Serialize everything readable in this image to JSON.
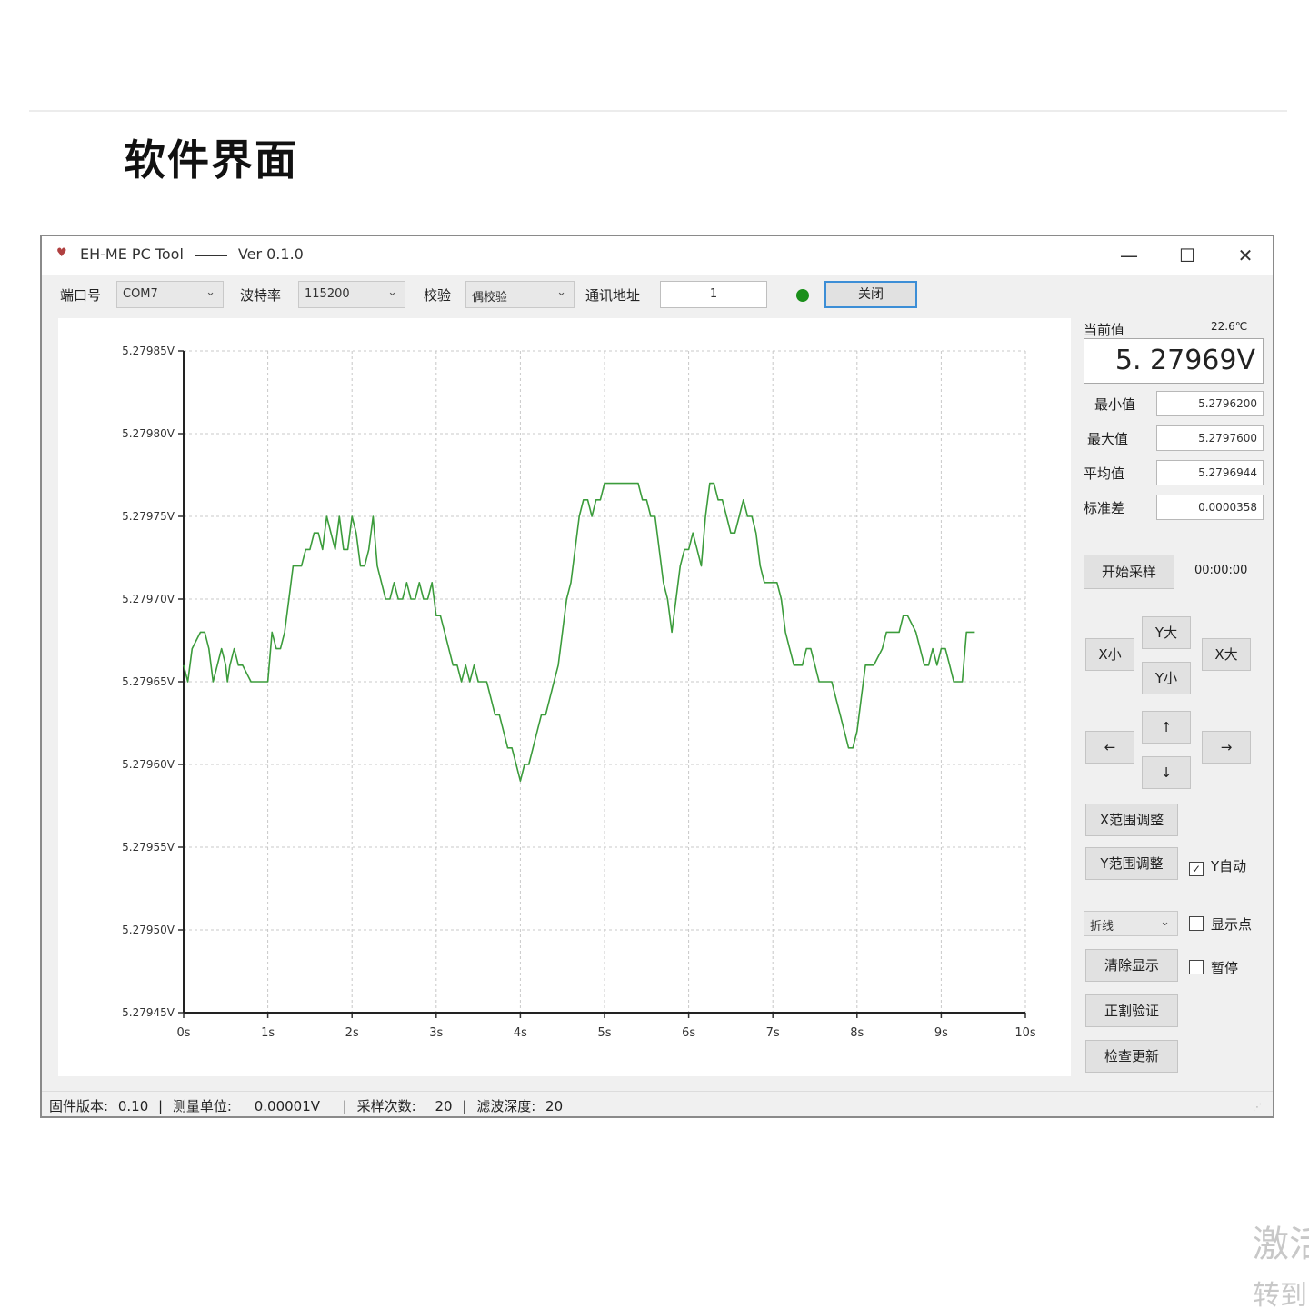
{
  "page": {
    "heading": "软件界面"
  },
  "window": {
    "title": "EH-ME PC Tool",
    "version": "Ver 0.1.0",
    "controls": {
      "minimize": "—",
      "maximize": "☐",
      "close": "✕"
    }
  },
  "toolbar": {
    "port_label": "端口号",
    "port_value": "COM7",
    "baud_label": "波特率",
    "baud_value": "115200",
    "parity_label": "校验",
    "parity_value": "偶校验",
    "address_label": "通讯地址",
    "address_value": "1",
    "connect_button": "关闭",
    "status_color": "#1a8f1a"
  },
  "panel": {
    "current_label": "当前值",
    "temperature": "22.6℃",
    "current_value": "5. 27969V",
    "stats": [
      {
        "label": "最小值",
        "value": "5.2796200"
      },
      {
        "label": "最大值",
        "value": "5.2797600"
      },
      {
        "label": "平均值",
        "value": "5.2796944"
      },
      {
        "label": "标准差",
        "value": "0.0000358"
      }
    ],
    "start_button": "开始采样",
    "timer": "00:00:00",
    "zoom": {
      "x_small": "X小",
      "y_big": "Y大",
      "y_small": "Y小",
      "x_big": "X大"
    },
    "arrows": {
      "left": "←",
      "up": "↑",
      "down": "↓",
      "right": "→"
    },
    "x_range_button": "X范围调整",
    "y_range_button": "Y范围调整",
    "y_auto_label": "Y自动",
    "y_auto_checked": true,
    "chart_type_value": "折线",
    "show_points_label": "显示点",
    "show_points_checked": false,
    "clear_button": "清除显示",
    "pause_label": "暂停",
    "pause_checked": false,
    "calibrate_button": "正割验证",
    "update_button": "检查更新"
  },
  "statusbar": {
    "fw_label": "固件版本:",
    "fw_value": "0.10",
    "unit_label": "测量单位:",
    "unit_value": "0.00001V",
    "samples_label": "采样次数:",
    "samples_value": "20",
    "filter_label": "滤波深度:",
    "filter_value": "20",
    "separator": "|"
  },
  "corner": {
    "line1": "激活",
    "line2": "转到"
  },
  "chart_data": {
    "type": "line",
    "color": "#3c9c3c",
    "x_ticks": [
      "0s",
      "1s",
      "2s",
      "3s",
      "4s",
      "5s",
      "6s",
      "7s",
      "8s",
      "9s",
      "10s"
    ],
    "y_ticks": [
      "5.27985V",
      "5.27980V",
      "5.27975V",
      "5.27970V",
      "5.27965V",
      "5.27960V",
      "5.27955V",
      "5.27950V",
      "5.27945V"
    ],
    "xlim": [
      0,
      10
    ],
    "ylim": [
      5.27945,
      5.27985
    ],
    "grid": true,
    "x": [
      0,
      0.05,
      0.1,
      0.2,
      0.25,
      0.3,
      0.35,
      0.45,
      0.5,
      0.52,
      0.55,
      0.6,
      0.65,
      0.7,
      0.8,
      0.85,
      0.9,
      1.0,
      1.05,
      1.1,
      1.15,
      1.2,
      1.25,
      1.3,
      1.35,
      1.4,
      1.45,
      1.5,
      1.55,
      1.6,
      1.65,
      1.7,
      1.75,
      1.8,
      1.85,
      1.9,
      1.95,
      2.0,
      2.05,
      2.1,
      2.15,
      2.2,
      2.25,
      2.3,
      2.35,
      2.4,
      2.45,
      2.5,
      2.55,
      2.6,
      2.65,
      2.7,
      2.75,
      2.8,
      2.85,
      2.9,
      2.95,
      3.0,
      3.05,
      3.1,
      3.15,
      3.2,
      3.25,
      3.3,
      3.35,
      3.4,
      3.45,
      3.5,
      3.6,
      3.65,
      3.7,
      3.75,
      3.8,
      3.85,
      3.9,
      3.95,
      4.0,
      4.05,
      4.1,
      4.15,
      4.2,
      4.25,
      4.3,
      4.35,
      4.4,
      4.45,
      4.5,
      4.55,
      4.6,
      4.65,
      4.7,
      4.75,
      4.8,
      4.85,
      4.9,
      4.95,
      5.0,
      5.1,
      5.2,
      5.3,
      5.4,
      5.45,
      5.5,
      5.55,
      5.6,
      5.65,
      5.7,
      5.75,
      5.8,
      5.85,
      5.9,
      5.95,
      6.0,
      6.05,
      6.1,
      6.15,
      6.2,
      6.25,
      6.3,
      6.35,
      6.4,
      6.45,
      6.5,
      6.55,
      6.6,
      6.65,
      6.7,
      6.75,
      6.8,
      6.85,
      6.9,
      7.0,
      7.05,
      7.1,
      7.15,
      7.2,
      7.25,
      7.3,
      7.35,
      7.4,
      7.45,
      7.5,
      7.55,
      7.6,
      7.65,
      7.7,
      7.75,
      7.8,
      7.85,
      7.9,
      7.95,
      8.0,
      8.05,
      8.1,
      8.15,
      8.2,
      8.3,
      8.35,
      8.4,
      8.5,
      8.55,
      8.6,
      8.7,
      8.8,
      8.85,
      8.9,
      8.95,
      9.0,
      9.05,
      9.1,
      9.15,
      9.2,
      9.25,
      9.3,
      9.4,
      9.45,
      9.5,
      9.6,
      9.65,
      9.7,
      9.75,
      9.85,
      9.9,
      9.95
    ],
    "y": [
      5.27966,
      5.27965,
      5.27967,
      5.27968,
      5.27968,
      5.27967,
      5.27965,
      5.27967,
      5.27966,
      5.27965,
      5.27966,
      5.27967,
      5.27966,
      5.27966,
      5.27965,
      5.27965,
      5.27965,
      5.27965,
      5.27968,
      5.27967,
      5.27967,
      5.27968,
      5.2797,
      5.27972,
      5.27972,
      5.27972,
      5.27973,
      5.27973,
      5.27974,
      5.27974,
      5.27973,
      5.27975,
      5.27974,
      5.27973,
      5.27975,
      5.27973,
      5.27973,
      5.27975,
      5.27974,
      5.27972,
      5.27972,
      5.27973,
      5.27975,
      5.27972,
      5.27971,
      5.2797,
      5.2797,
      5.27971,
      5.2797,
      5.2797,
      5.27971,
      5.2797,
      5.2797,
      5.27971,
      5.2797,
      5.2797,
      5.27971,
      5.27969,
      5.27969,
      5.27968,
      5.27967,
      5.27966,
      5.27966,
      5.27965,
      5.27966,
      5.27965,
      5.27966,
      5.27965,
      5.27965,
      5.27964,
      5.27963,
      5.27963,
      5.27962,
      5.27961,
      5.27961,
      5.2796,
      5.27959,
      5.2796,
      5.2796,
      5.27961,
      5.27962,
      5.27963,
      5.27963,
      5.27964,
      5.27965,
      5.27966,
      5.27968,
      5.2797,
      5.27971,
      5.27973,
      5.27975,
      5.27976,
      5.27976,
      5.27975,
      5.27976,
      5.27976,
      5.27977,
      5.27977,
      5.27977,
      5.27977,
      5.27977,
      5.27976,
      5.27976,
      5.27975,
      5.27975,
      5.27973,
      5.27971,
      5.2797,
      5.27968,
      5.2797,
      5.27972,
      5.27973,
      5.27973,
      5.27974,
      5.27973,
      5.27972,
      5.27975,
      5.27977,
      5.27977,
      5.27976,
      5.27976,
      5.27975,
      5.27974,
      5.27974,
      5.27975,
      5.27976,
      5.27975,
      5.27975,
      5.27974,
      5.27972,
      5.27971,
      5.27971,
      5.27971,
      5.2797,
      5.27968,
      5.27967,
      5.27966,
      5.27966,
      5.27966,
      5.27967,
      5.27967,
      5.27966,
      5.27965,
      5.27965,
      5.27965,
      5.27965,
      5.27964,
      5.27963,
      5.27962,
      5.27961,
      5.27961,
      5.27962,
      5.27964,
      5.27966,
      5.27966,
      5.27966,
      5.27967,
      5.27968,
      5.27968,
      5.27968,
      5.27969,
      5.27969,
      5.27968,
      5.27966,
      5.27966,
      5.27967,
      5.27966,
      5.27967,
      5.27967,
      5.27966,
      5.27965,
      5.27965,
      5.27965,
      5.27968,
      5.27968
    ]
  }
}
